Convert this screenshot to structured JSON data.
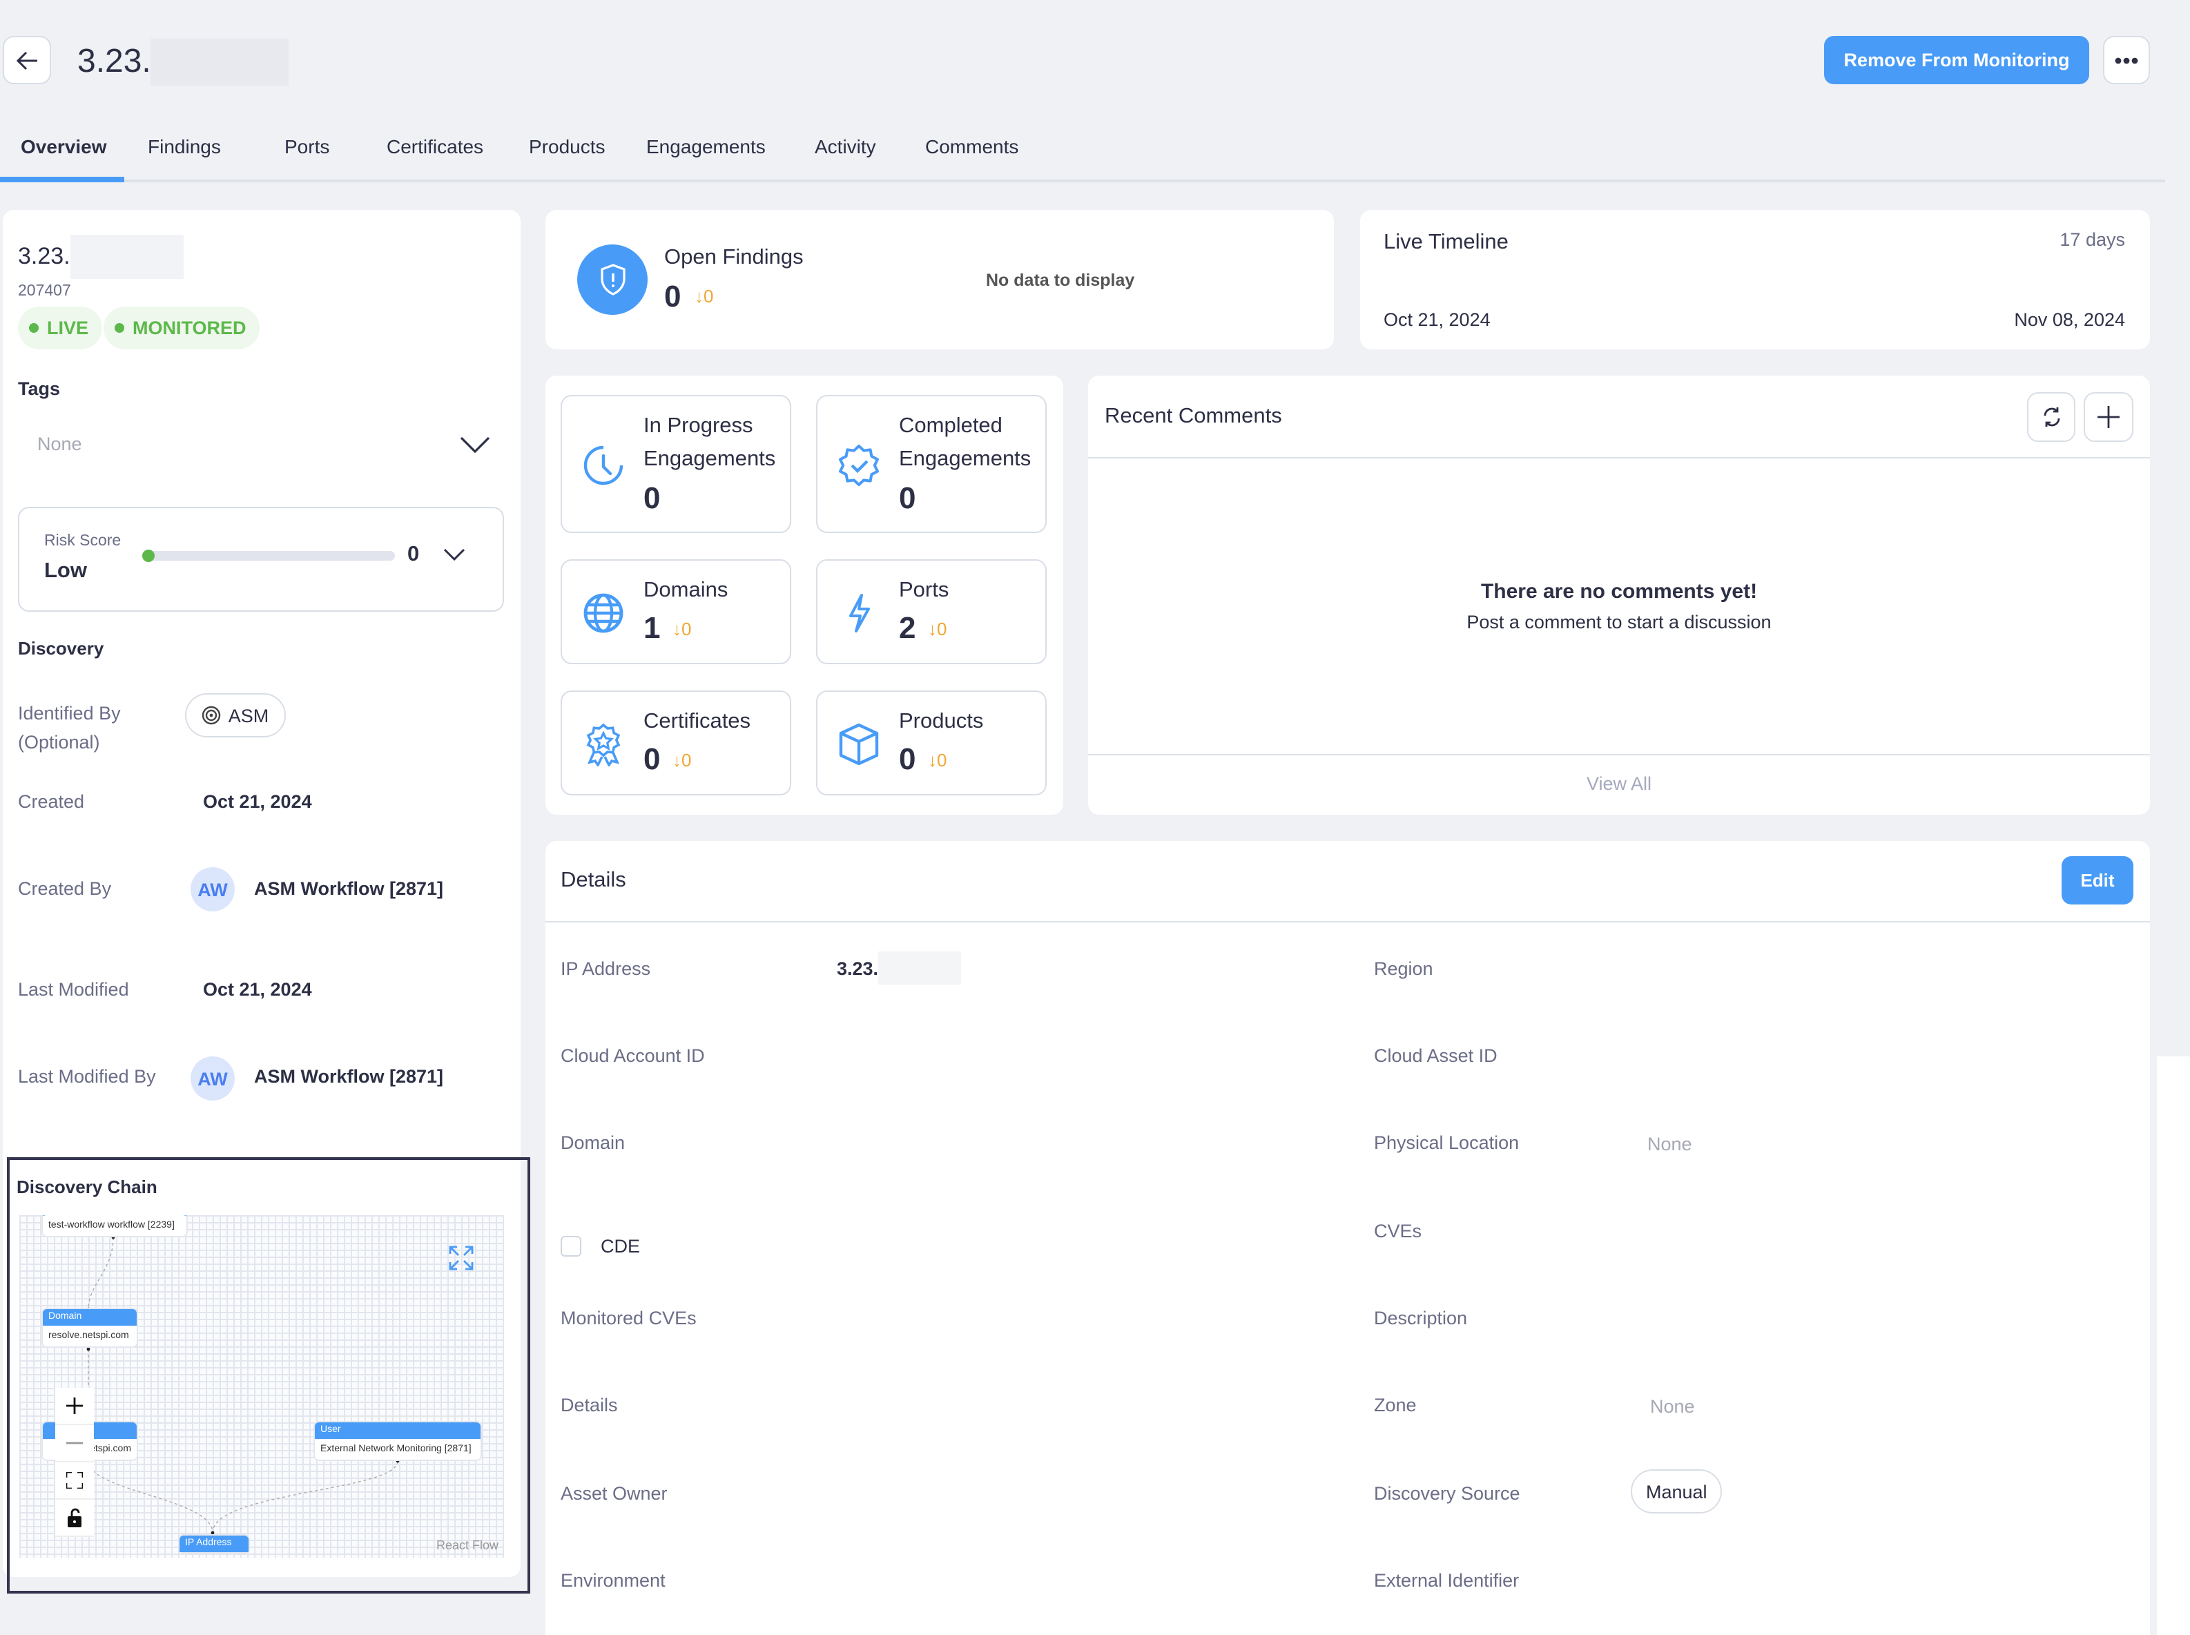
{
  "header": {
    "title_prefix": "3.23.",
    "remove_button": "Remove From Monitoring",
    "more_icon": "ellipsis-icon",
    "back_icon": "arrow-left-icon"
  },
  "tabs": [
    {
      "label": "Overview",
      "active": true
    },
    {
      "label": "Findings"
    },
    {
      "label": "Ports"
    },
    {
      "label": "Certificates"
    },
    {
      "label": "Products"
    },
    {
      "label": "Engagements"
    },
    {
      "label": "Activity"
    },
    {
      "label": "Comments"
    }
  ],
  "asset": {
    "name_prefix": "3.23.",
    "id": "207407",
    "badges": [
      "LIVE",
      "MONITORED"
    ],
    "tags_label": "Tags",
    "tags_placeholder": "None",
    "risk": {
      "label": "Risk Score",
      "level": "Low",
      "score": "0",
      "fraction": 0
    },
    "discovery_label": "Discovery",
    "identified_by_label_1": "Identified By",
    "identified_by_label_2": "(Optional)",
    "identified_by_value": "ASM",
    "created_label": "Created",
    "created_value": "Oct 21, 2024",
    "created_by_label": "Created By",
    "created_by_initials": "AW",
    "created_by_value": "ASM Workflow [2871]",
    "last_modified_label": "Last Modified",
    "last_modified_value": "Oct 21, 2024",
    "last_modified_by_label": "Last Modified By",
    "last_modified_by_initials": "AW",
    "last_modified_by_value": "ASM Workflow [2871]"
  },
  "discovery_chain": {
    "title": "Discovery Chain",
    "nodes": [
      {
        "type": "",
        "label": "test-workflow workflow [2239]"
      },
      {
        "type": "Domain",
        "label": "resolve.netspi.com"
      },
      {
        "type": "",
        "label": "e.netspi.com"
      },
      {
        "type": "User",
        "label": "External Network Monitoring [2871]"
      },
      {
        "type": "IP Address",
        "label": ""
      }
    ],
    "attribution": "React Flow"
  },
  "open_findings": {
    "title": "Open Findings",
    "value": "0",
    "delta": "0",
    "empty_text": "No data to display"
  },
  "live_timeline": {
    "title": "Live Timeline",
    "duration": "17 days",
    "start": "Oct 21, 2024",
    "end": "Nov 08, 2024"
  },
  "stats": [
    {
      "label_1": "In Progress",
      "label_2": "Engagements",
      "value": "0",
      "icon": "clock-icon"
    },
    {
      "label_1": "Completed",
      "label_2": "Engagements",
      "value": "0",
      "icon": "verified-badge-icon"
    },
    {
      "label_1": "Domains",
      "value": "1",
      "delta": "0",
      "icon": "globe-icon"
    },
    {
      "label_1": "Ports",
      "value": "2",
      "delta": "0",
      "icon": "lightning-icon"
    },
    {
      "label_1": "Certificates",
      "value": "0",
      "delta": "0",
      "icon": "award-icon"
    },
    {
      "label_1": "Products",
      "value": "0",
      "delta": "0",
      "icon": "box-icon"
    }
  ],
  "comments": {
    "title": "Recent Comments",
    "empty_title": "There are no comments yet!",
    "empty_subtitle": "Post a comment to start a discussion",
    "view_all": "View All"
  },
  "details": {
    "title": "Details",
    "edit_button": "Edit",
    "ip_label": "IP Address",
    "ip_value_prefix": "3.23.",
    "left": [
      "Cloud Account ID",
      "Domain"
    ],
    "cde_label": "CDE",
    "cde_checked": false,
    "left2": [
      "Monitored CVEs",
      "Details",
      "Asset Owner",
      "Environment"
    ],
    "right": [
      {
        "label": "Region",
        "value": ""
      },
      {
        "label": "Cloud Asset ID",
        "value": ""
      },
      {
        "label": "Physical Location",
        "value": "None"
      },
      {
        "label": "CVEs",
        "value": ""
      },
      {
        "label": "Description",
        "value": ""
      },
      {
        "label": "Zone",
        "value": "None"
      },
      {
        "label": "Discovery Source",
        "value": "Manual"
      },
      {
        "label": "External Identifier",
        "value": ""
      }
    ]
  },
  "colors": {
    "accent": "#489cf7",
    "live_green": "#5cb84a",
    "delta_orange": "#f0a733"
  }
}
